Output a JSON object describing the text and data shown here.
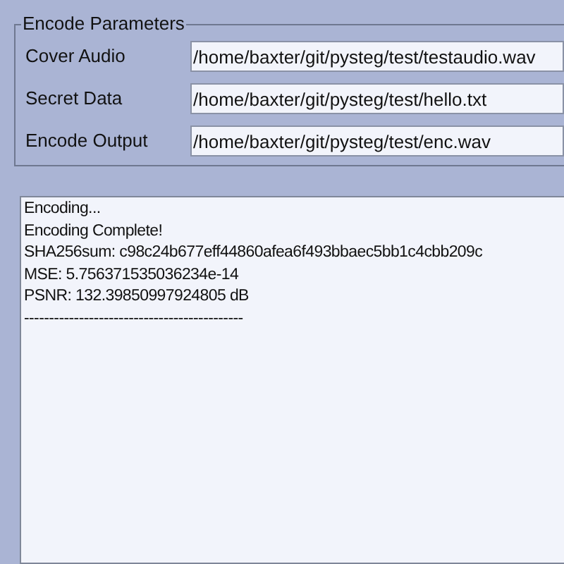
{
  "group": {
    "title": "Encode Parameters",
    "fields": [
      {
        "label": "Cover Audio",
        "value": "/home/baxter/git/pysteg/test/testaudio.wav"
      },
      {
        "label": "Secret Data",
        "value": "/home/baxter/git/pysteg/test/hello.txt"
      },
      {
        "label": "Encode Output",
        "value": "/home/baxter/git/pysteg/test/enc.wav"
      }
    ]
  },
  "log": {
    "lines": [
      "Encoding...",
      "Encoding Complete!",
      "SHA256sum: c98c24b677eff44860afea6f493bbaec5bb1c4cbb209c",
      "MSE: 5.756371535036234e-14",
      "PSNR: 132.39850997924805 dB",
      "--------------------------------------------"
    ]
  }
}
